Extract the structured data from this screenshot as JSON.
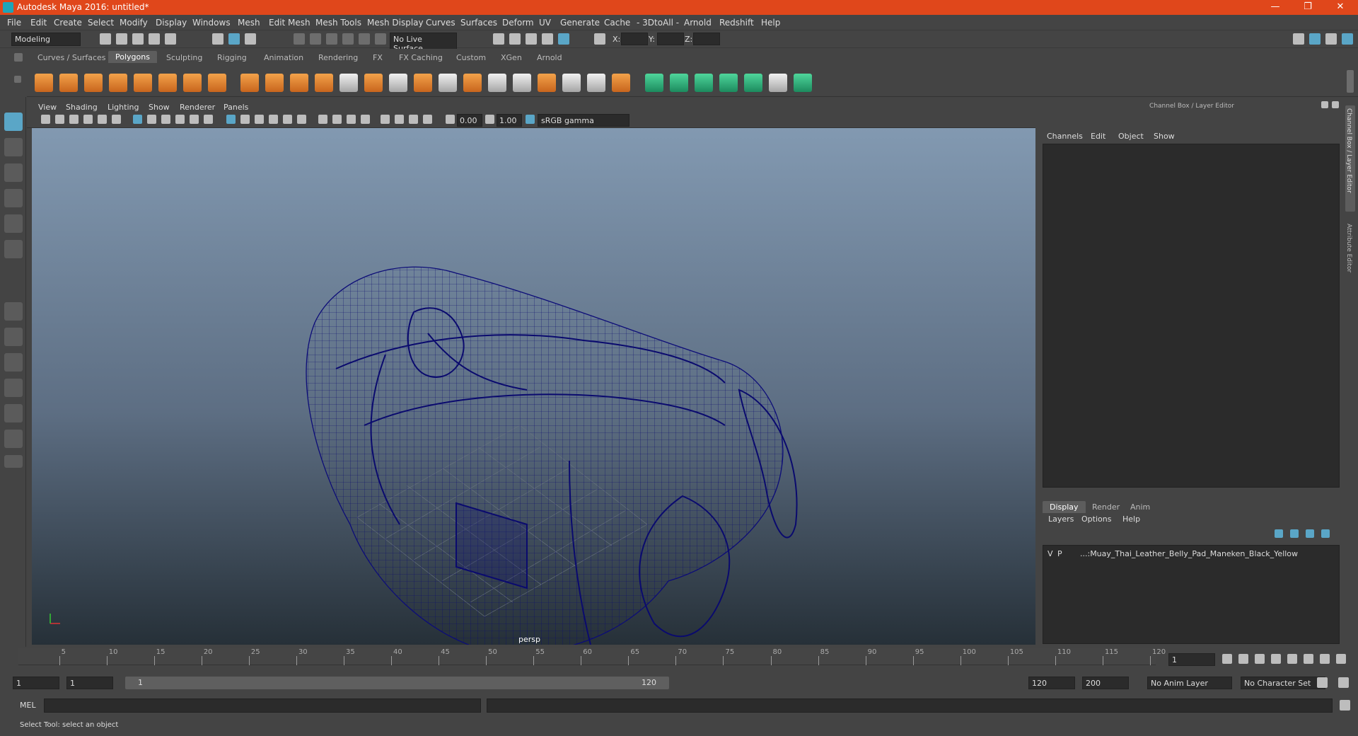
{
  "window": {
    "title": "Autodesk Maya 2016: untitled*",
    "minimize": "—",
    "restore": "❐",
    "close": "✕"
  },
  "menus": [
    "File",
    "Edit",
    "Create",
    "Select",
    "Modify",
    "Display",
    "Windows",
    "Mesh",
    "Edit Mesh",
    "Mesh Tools",
    "Mesh Display",
    "Curves",
    "Surfaces",
    "Deform",
    "UV",
    "Generate",
    "Cache",
    "- 3DtoAll -",
    "Arnold",
    "Redshift",
    "Help"
  ],
  "status": {
    "mode": "Modeling",
    "live_surface": "No Live Surface",
    "x_label": "X:",
    "y_label": "Y:",
    "z_label": "Z:"
  },
  "shelf_tabs": [
    "Curves / Surfaces",
    "Polygons",
    "Sculpting",
    "Rigging",
    "Animation",
    "Rendering",
    "FX",
    "FX Caching",
    "Custom",
    "XGen",
    "Arnold"
  ],
  "active_shelf": "Polygons",
  "viewport": {
    "menus": [
      "View",
      "Shading",
      "Lighting",
      "Show",
      "Renderer",
      "Panels"
    ],
    "exposure": "0.00",
    "gamma": "1.00",
    "color_space": "sRGB gamma",
    "camera": "persp"
  },
  "channel_box": {
    "title": "Channel Box / Layer Editor",
    "menus": [
      "Channels",
      "Edit",
      "Object",
      "Show"
    ],
    "layer_tabs": [
      "Display",
      "Render",
      "Anim"
    ],
    "layer_menus": [
      "Layers",
      "Options",
      "Help"
    ],
    "layer": {
      "v": "V",
      "p": "P",
      "name": "...:Muay_Thai_Leather_Belly_Pad_Maneken_Black_Yellow"
    }
  },
  "side_tabs": [
    "Channel Box / Layer Editor",
    "Attribute Editor"
  ],
  "timeline": {
    "ticks": [
      5,
      10,
      15,
      20,
      25,
      30,
      35,
      40,
      45,
      50,
      55,
      60,
      65,
      70,
      75,
      80,
      85,
      90,
      95,
      100,
      105,
      110,
      115,
      120
    ],
    "start_label": "1",
    "current_frame": "1"
  },
  "range": {
    "start": "1",
    "playback_start": "1",
    "slider_start": "1",
    "slider_end": "120",
    "playback_end": "120",
    "end": "200",
    "anim_layer": "No Anim Layer",
    "character_set": "No Character Set"
  },
  "command": {
    "label": "MEL"
  },
  "help_line": "Select Tool: select an object"
}
